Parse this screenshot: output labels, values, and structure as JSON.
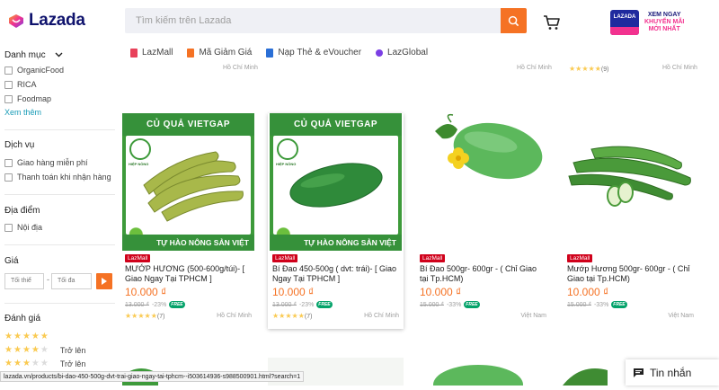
{
  "header": {
    "logo_text": "Lazada",
    "search_placeholder": "Tìm kiếm trên Lazada",
    "promo_line1": "XEM NGAY",
    "promo_line2": "KHUYẾN MÃI",
    "promo_line3": "MỚI NHẤT",
    "promo_badge_text": "LAZADA"
  },
  "colors": {
    "accent": "#f57224",
    "brand": "#0f136d",
    "link": "#1a9cb7",
    "mall": "#d0011b",
    "free": "#04a36a",
    "green": "#36913a"
  },
  "sidebar": {
    "category_title": "Danh mục",
    "categories": [
      "OrganicFood",
      "RICA",
      "Foodmap"
    ],
    "see_more": "Xem thêm",
    "service_title": "Dịch vụ",
    "services": [
      "Giao hàng miễn phí",
      "Thanh toán khi nhận hàng"
    ],
    "location_title": "Địa điểm",
    "locations": [
      "Nội địa"
    ],
    "price_title": "Giá",
    "price_min_placeholder": "Tối thiể",
    "price_max_placeholder": "Tối đa",
    "price_dash": "-",
    "rating_title": "Đánh giá",
    "rating_options": [
      {
        "stars": 5,
        "label": ""
      },
      {
        "stars": 4,
        "label": "Trở lên"
      },
      {
        "stars": 3,
        "label": "Trở lên"
      }
    ]
  },
  "topnav": [
    {
      "label": "LazMall",
      "icon": "lazmall-icon",
      "color": "#e8415a"
    },
    {
      "label": "Mã Giảm Giá",
      "icon": "voucher-icon",
      "color": "#f57224"
    },
    {
      "label": "Nạp Thẻ & eVoucher",
      "icon": "phone-card-icon",
      "color": "#2a6fd6"
    },
    {
      "label": "LazGlobal",
      "icon": "globe-icon",
      "color": "#7b3fe4"
    }
  ],
  "previous_row": {
    "locations": [
      "Hồ Chí Minh",
      "Hồ Chí Minh",
      "Hồ Chí Minh"
    ],
    "last_rating_count": "(9)"
  },
  "products": [
    {
      "image_style": "vietgap",
      "image_banner": "CỦ QUẢ VIETGAP",
      "image_footer": "TỰ HÀO NÔNG SẢN VIỆT",
      "image_brand": "HIỆP NÔNG",
      "badge": "LazMall",
      "name": "MƯỚP HƯƠNG (500-600g/túi)- [ Giao Ngay Tại TPHCM ]",
      "price": "10.000 ₫",
      "original_price": "13.000 ₫",
      "discount": "-23%",
      "free_label": "FREE",
      "stars": 5,
      "reviews": "(7)",
      "location": "Hồ Chí Minh"
    },
    {
      "image_style": "vietgap",
      "image_banner": "CỦ QUẢ VIETGAP",
      "image_footer": "TỰ HÀO NÔNG SẢN VIỆT",
      "image_brand": "HIỆP NÔNG",
      "badge": "LazMall",
      "name": "Bí Đao 450-500g ( dvt: trái)- [ Giao Ngay Tại TPHCM ]",
      "price": "10.000 ₫",
      "original_price": "13.000 ₫",
      "discount": "-23%",
      "free_label": "FREE",
      "stars": 5,
      "reviews": "(7)",
      "location": "Hồ Chí Minh"
    },
    {
      "image_style": "plain",
      "badge": "LazMall",
      "name": "Bí Đao 500gr- 600gr - ( Chỉ Giao tại Tp.HCM)",
      "price": "10.000 ₫",
      "original_price": "15.000 ₫",
      "discount": "-33%",
      "free_label": "FREE",
      "stars": 0,
      "reviews": "",
      "location": "Việt Nam"
    },
    {
      "image_style": "plain",
      "badge": "LazMall",
      "name": "Mướp Hương 500gr- 600gr - ( Chỉ Giao tại Tp.HCM)",
      "price": "10.000 ₫",
      "original_price": "15.000 ₫",
      "discount": "-33%",
      "free_label": "FREE",
      "stars": 0,
      "reviews": "",
      "location": "Việt Nam"
    }
  ],
  "status_url": "lazada.vn/products/bi-dao-450-500g-dvt-trai-giao-ngay-tai-tphcm--i503614936-s988500901.html?search=1",
  "chat_label": "Tin nhắn"
}
